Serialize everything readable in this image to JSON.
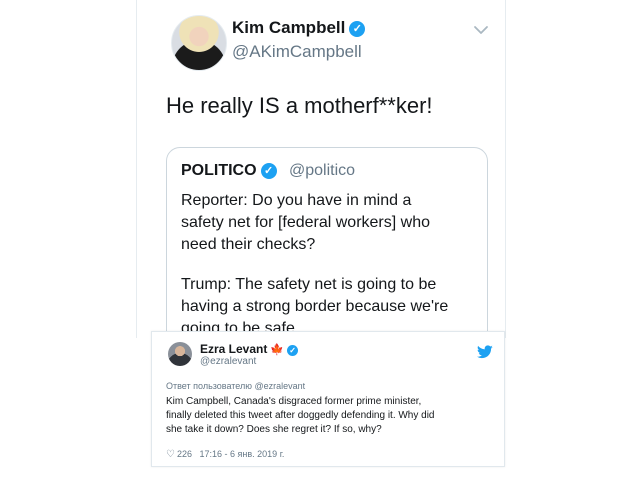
{
  "top_tweet": {
    "name": "Kim Campbell",
    "handle": "@AKimCampbell",
    "text": "He really IS a motherf**ker!",
    "quoted": {
      "name": "POLITICO",
      "handle": "@politico",
      "lines": [
        "Reporter: Do you have in mind a",
        "safety net for [federal workers] who",
        "need their checks?",
        "",
        "Trump: The safety net is going to be",
        "having a strong border because we're",
        "going to be safe"
      ]
    }
  },
  "bottom_tweet": {
    "name": "Ezra Levant",
    "flag": "🍁",
    "handle": "@ezralevant",
    "reply_to": "Ответ пользователю @ezralevant",
    "lines": [
      "Kim Campbell, Canada's disgraced former prime minister,",
      "finally deleted this tweet after doggedly defending it. Why did",
      "she take it down? Does she regret it? If so, why?"
    ],
    "likes": "226",
    "timestamp": "17:16 - 6 янв. 2019 г."
  },
  "icons": {
    "verified": "verified-badge-icon",
    "chevron": "chevron-down-icon",
    "twitter": "twitter-bird-icon",
    "heart": "heart-icon"
  },
  "colors": {
    "twitter_blue": "#1da1f2",
    "text": "#14171a",
    "muted": "#657786",
    "maple_red": "#e0242f"
  }
}
